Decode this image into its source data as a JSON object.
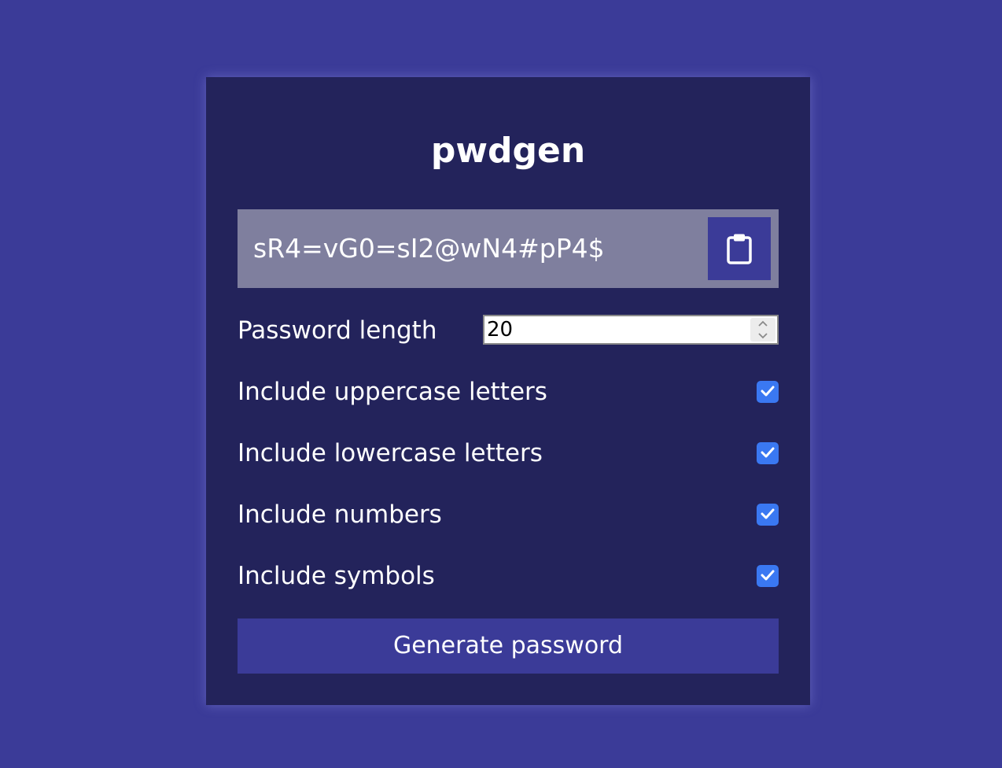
{
  "app": {
    "title": "pwdgen"
  },
  "result": {
    "password": "sR4=vG0=sI2@wN4#pP4$",
    "copy_icon": "clipboard-icon"
  },
  "settings": {
    "length": {
      "label": "Password length",
      "value": "20"
    },
    "options": [
      {
        "label": "Include uppercase letters",
        "checked": true
      },
      {
        "label": "Include lowercase letters",
        "checked": true
      },
      {
        "label": "Include numbers",
        "checked": true
      },
      {
        "label": "Include symbols",
        "checked": true
      }
    ]
  },
  "actions": {
    "generate_label": "Generate password"
  },
  "colors": {
    "page_background": "#3b3b98",
    "card_background": "#23235b",
    "result_background": "#7f7f9e",
    "accent": "#3b3b98",
    "checkbox": "#3a78f2",
    "text": "#ffffff"
  }
}
